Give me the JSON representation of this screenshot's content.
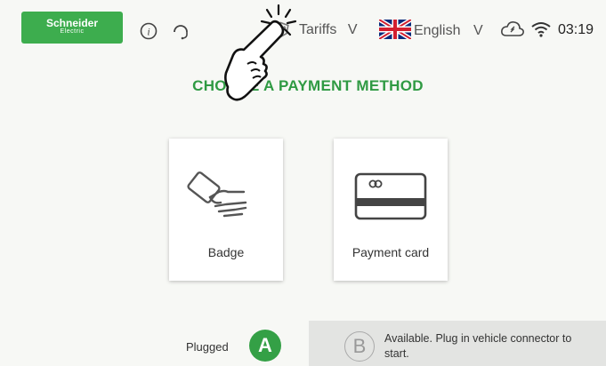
{
  "header": {
    "logo": {
      "line1": "Schneider",
      "line2": "Electric"
    },
    "info_icon": "info-icon",
    "support_icon": "headset-icon",
    "tariffs_label": "Tariffs",
    "tariffs_chevron": "V",
    "language_label": "English",
    "language_chevron": "V",
    "language_flag": "uk-flag-icon",
    "cloud_icon": "cloud-connection-icon",
    "wifi_icon": "wifi-icon",
    "time": "03:19"
  },
  "main": {
    "title": "CHOOSE A PAYMENT METHOD",
    "options": [
      {
        "label": "Badge",
        "icon": "badge-hand-icon"
      },
      {
        "label": "Payment card",
        "icon": "payment-card-icon"
      }
    ]
  },
  "connectors": {
    "a": {
      "status": "Plugged",
      "letter": "A",
      "color": "#34a046"
    },
    "b": {
      "letter": "B",
      "status": "Available. Plug in vehicle connector to start."
    }
  },
  "overlay": {
    "icon": "tap-hand-icon"
  },
  "colors": {
    "brand_green": "#3dad4e",
    "title_green": "#2f9a43"
  }
}
